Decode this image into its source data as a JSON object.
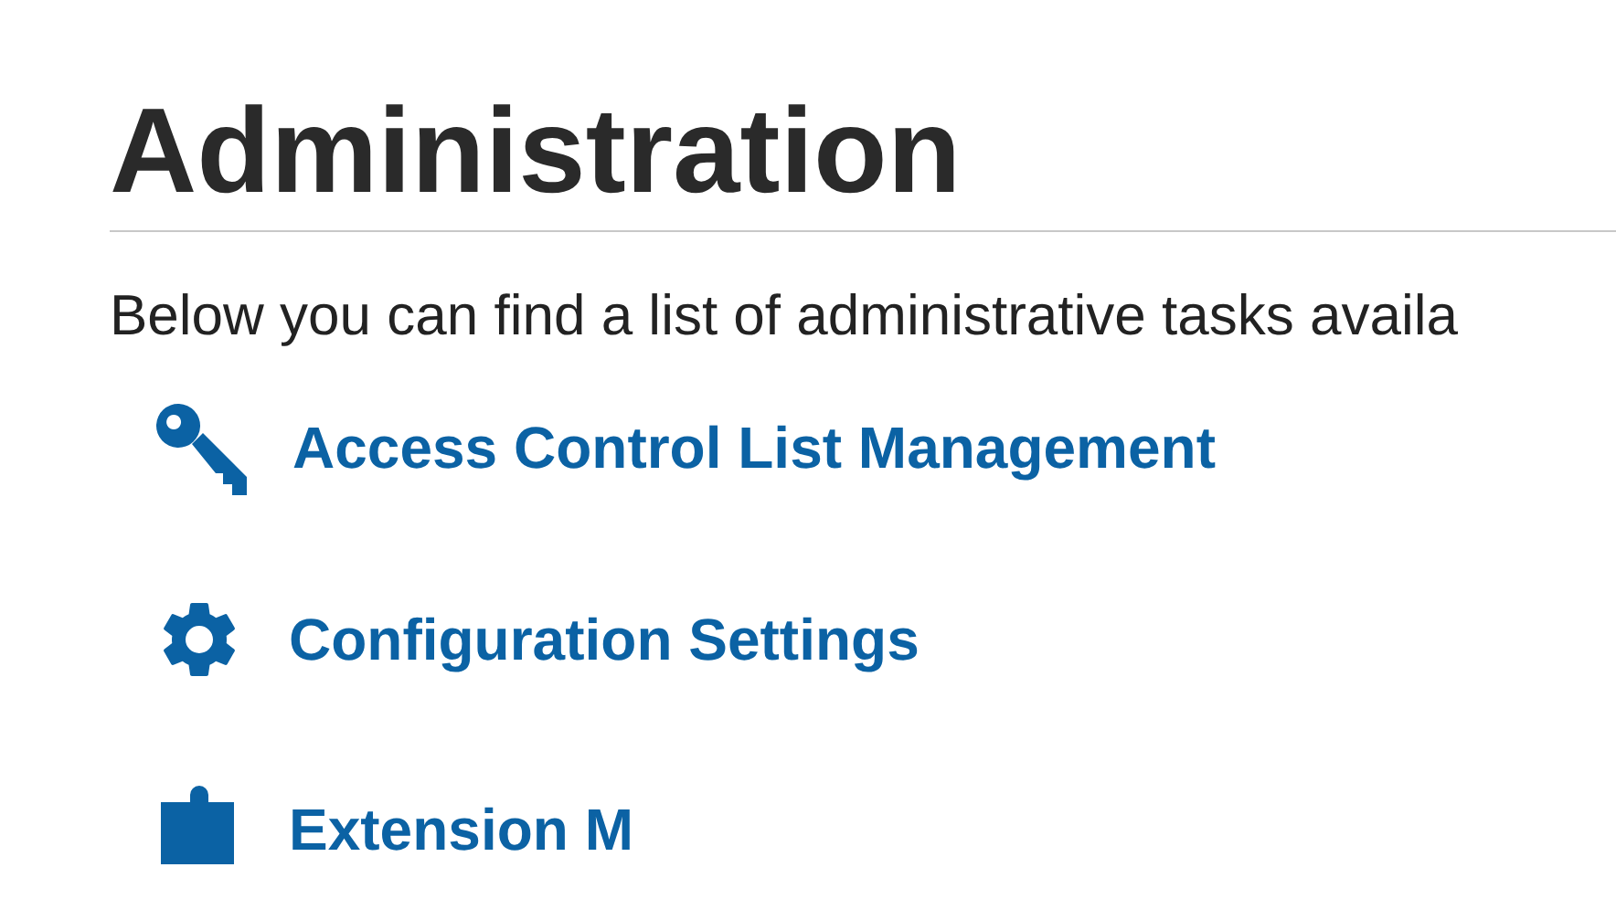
{
  "title": "Administration",
  "intro": "Below you can find a list of administrative tasks availa",
  "tasks": [
    {
      "kind": "key",
      "label": "Access Control List Management"
    },
    {
      "kind": "gear",
      "label": "Configuration Settings"
    },
    {
      "kind": "puzzle",
      "label": "Extension M"
    }
  ]
}
